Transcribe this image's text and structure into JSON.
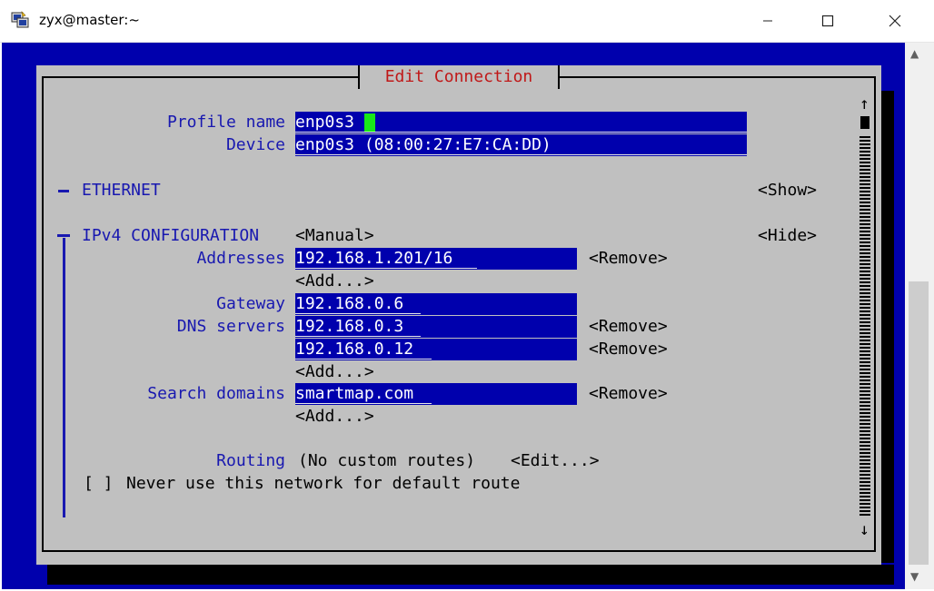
{
  "window": {
    "title": "zyx@master:~"
  },
  "dialog": {
    "title": "Edit Connection"
  },
  "labels": {
    "profile_name": "Profile name",
    "device": "Device",
    "addresses": "Addresses",
    "gateway": "Gateway",
    "dns_servers": "DNS servers",
    "search_domains": "Search domains",
    "routing": "Routing"
  },
  "fields": {
    "profile_name": "enp0s3",
    "device": "enp0s3 (08:00:27:E7:CA:DD)",
    "address_1": "192.168.1.201/16",
    "gateway": "192.168.0.6",
    "dns_1": "192.168.0.3",
    "dns_2": "192.168.0.12",
    "search_1": "smartmap.com"
  },
  "sections": {
    "ethernet": "ETHERNET",
    "ethernet_toggle": "<Show>",
    "ipv4": "IPv4 CONFIGURATION",
    "ipv4_method": "<Manual>",
    "ipv4_toggle": "<Hide>"
  },
  "buttons": {
    "remove": "<Remove>",
    "add": "<Add...>",
    "routing_edit": "<Edit...>"
  },
  "routing": {
    "value": "(No custom routes)"
  },
  "checkbox": {
    "box": "[ ]",
    "label": "Never use this network for default route"
  },
  "scroll": {
    "up": "↑",
    "down": "↓"
  },
  "icons": {
    "app": "putty-icon"
  }
}
